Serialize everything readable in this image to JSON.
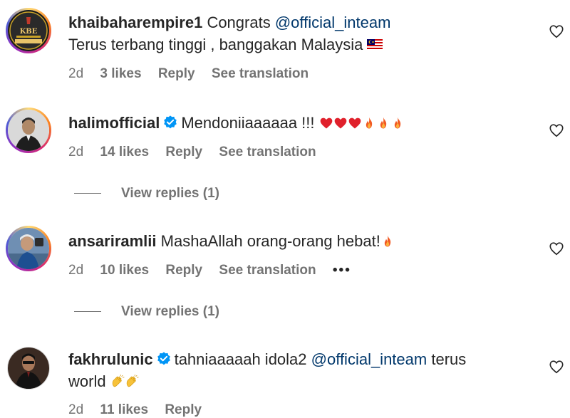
{
  "comments": [
    {
      "username": "khaibaharempire1",
      "text_before": "Congrats",
      "mention": "@official_inteam",
      "text_line2": "Terus terbang tinggi , banggakan Malaysia",
      "flag": "malaysia-flag",
      "time": "2d",
      "likes": "3 likes",
      "reply": "Reply",
      "translate": "See translation",
      "avatar_text": "KBE"
    },
    {
      "username": "halimofficial",
      "verified": true,
      "text": "Mendoniiaaaaaa !!!",
      "emojis": [
        "heart",
        "heart",
        "heart",
        "fire",
        "fire",
        "fire"
      ],
      "time": "2d",
      "likes": "14 likes",
      "reply": "Reply",
      "translate": "See translation",
      "view_replies": "View replies (1)"
    },
    {
      "username": "ansariramlii",
      "text": "MashaAllah orang-orang hebat!",
      "emojis": [
        "fire"
      ],
      "time": "2d",
      "likes": "10 likes",
      "reply": "Reply",
      "translate": "See translation",
      "more": "•••",
      "view_replies": "View replies (1)"
    },
    {
      "username": "fakhrulunic",
      "verified": true,
      "text_before": "tahniaaaaah idola2",
      "mention": "@official_inteam",
      "text_after": "terus",
      "text_line2": "world",
      "emojis": [
        "clap",
        "clap"
      ],
      "time": "2d",
      "likes": "11 likes",
      "reply": "Reply"
    }
  ],
  "colors": {
    "text": "#262626",
    "meta": "#737373",
    "mention": "#00376b",
    "verified": "#0095f6"
  }
}
